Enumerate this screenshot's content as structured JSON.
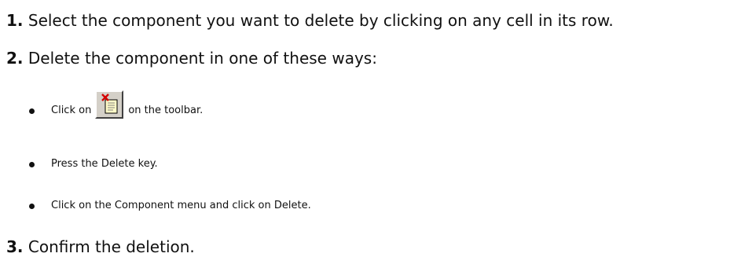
{
  "steps": [
    {
      "number": "1.",
      "text": "Select the component you want to delete by clicking on any cell in its row."
    },
    {
      "number": "2.",
      "text": "Delete the component in one of these ways:"
    },
    {
      "number": "3.",
      "text": "Confirm the deletion."
    }
  ],
  "bullets": [
    {
      "before": "Click on",
      "icon": "delete-component-icon",
      "after": "on the toolbar."
    },
    {
      "text": "Press the Delete key."
    },
    {
      "text": "Click on the Component menu and click on Delete."
    }
  ]
}
